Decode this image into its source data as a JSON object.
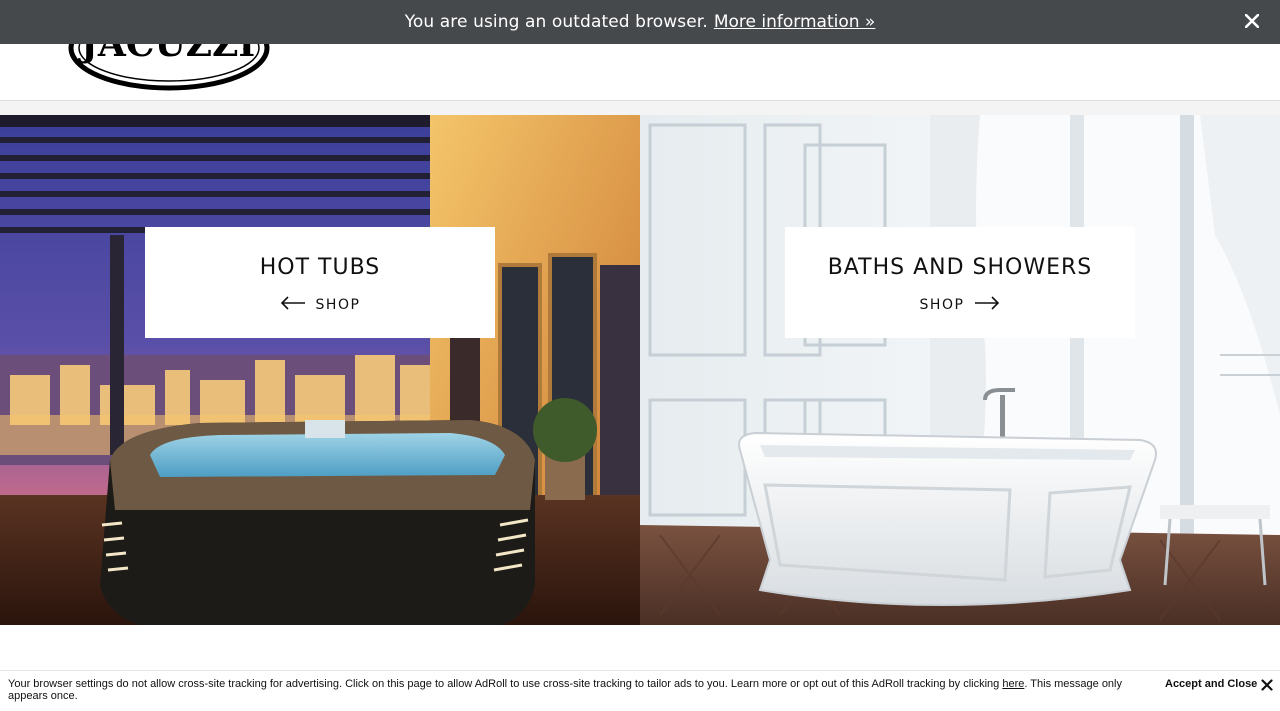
{
  "browser_notice": {
    "message": "You are using an outdated browser.",
    "link_label": "More information »",
    "close_icon": "close-icon"
  },
  "header": {
    "logo_text": "JACUZZI",
    "logo_mark": "®"
  },
  "panels": [
    {
      "title": "HOT TUBS",
      "shop_label": "SHOP",
      "arrow_icon": "arrow-left-icon"
    },
    {
      "title": "BATHS AND SHOWERS",
      "shop_label": "SHOP",
      "arrow_icon": "arrow-right-icon"
    }
  ],
  "consent": {
    "text_before": "Your browser settings do not allow cross-site tracking for advertising. Click on this page to allow AdRoll to use cross-site tracking to tailor ads to you. Learn more or opt out of this AdRoll tracking by clicking ",
    "link_label": "here",
    "text_after": ". This message only appears once.",
    "accept_label": "Accept and Close",
    "close_icon": "close-icon"
  },
  "colors": {
    "notice_bg": "#46494c",
    "header_border": "#dcdcdc",
    "text": "#111111"
  }
}
